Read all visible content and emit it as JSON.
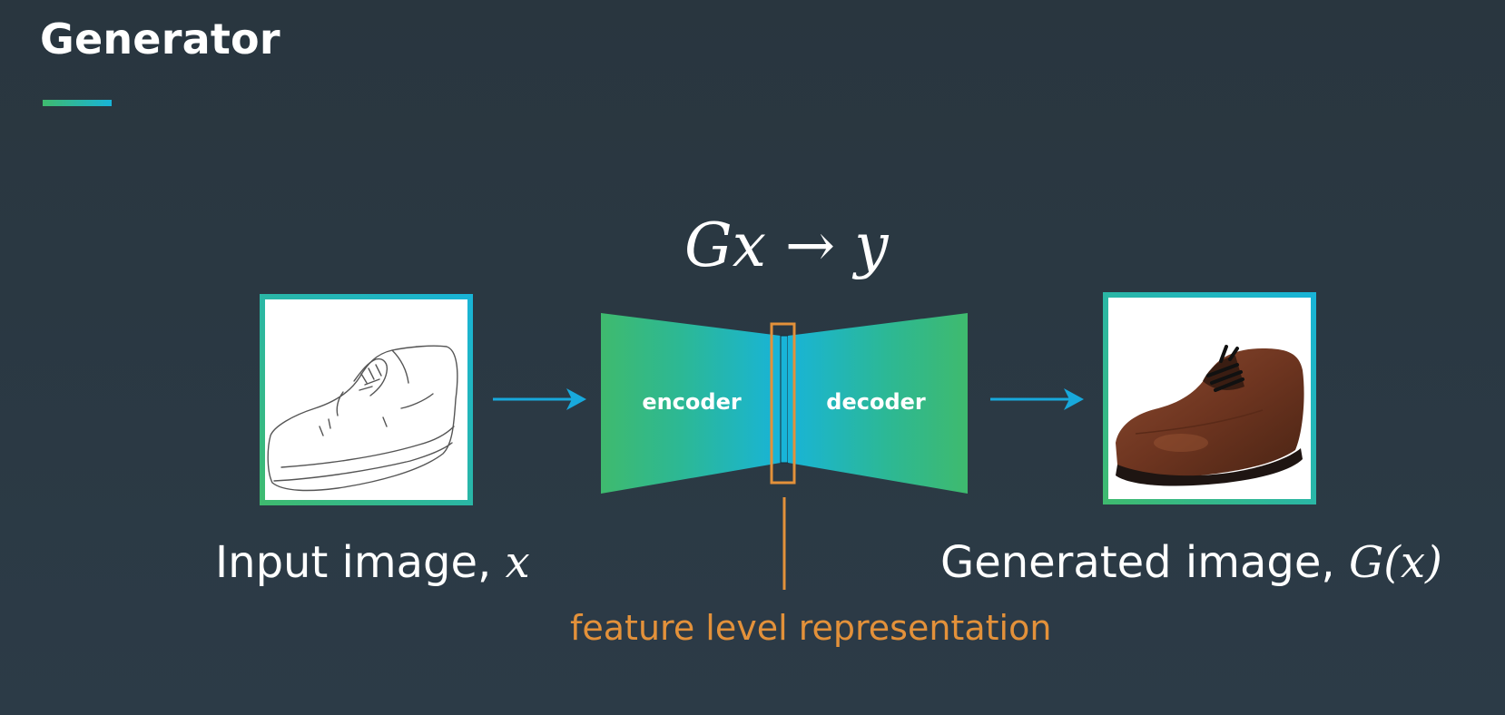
{
  "slide": {
    "title": "Generator",
    "accent_colors": {
      "green": "#3fba6e",
      "blue": "#18b4d8",
      "orange": "#e3913a"
    }
  },
  "formula": "Gx → y",
  "input_image": {
    "caption": "Input image, ",
    "caption_math": "x",
    "icon": "shoe-sketch-image"
  },
  "generator": {
    "encoder_label": "encoder",
    "decoder_label": "decoder"
  },
  "feature_label": "feature level representation",
  "output_image": {
    "caption": "Generated image, ",
    "caption_math": "G(x)",
    "icon": "brown-shoe-image"
  }
}
